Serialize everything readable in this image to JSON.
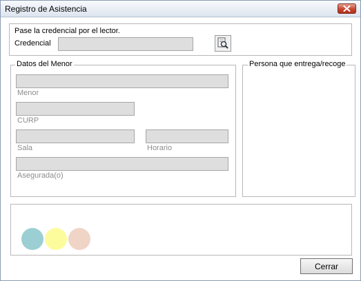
{
  "window": {
    "title": "Registro de Asistencia"
  },
  "credencial": {
    "instruction": "Pase la credencial por el lector.",
    "label": "Credencial",
    "value": ""
  },
  "menor": {
    "legend": "Datos del Menor",
    "fields": {
      "menor": {
        "caption": "Menor",
        "value": ""
      },
      "curp": {
        "caption": "CURP",
        "value": ""
      },
      "sala": {
        "caption": "Sala",
        "value": ""
      },
      "horario": {
        "caption": "Horario",
        "value": ""
      },
      "asegurada": {
        "caption": "Asegurada(o)",
        "value": ""
      }
    }
  },
  "persona": {
    "legend": "Persona que entrega/recoge"
  },
  "status": {
    "indicators": [
      {
        "name": "teal-indicator",
        "color": "#9ccfd3"
      },
      {
        "name": "yellow-indicator",
        "color": "#fcfc9c"
      },
      {
        "name": "peach-indicator",
        "color": "#f0d4c6"
      }
    ]
  },
  "buttons": {
    "cerrar": "Cerrar"
  },
  "icons": {
    "close": "close-icon",
    "scan": "scan-card-icon"
  }
}
